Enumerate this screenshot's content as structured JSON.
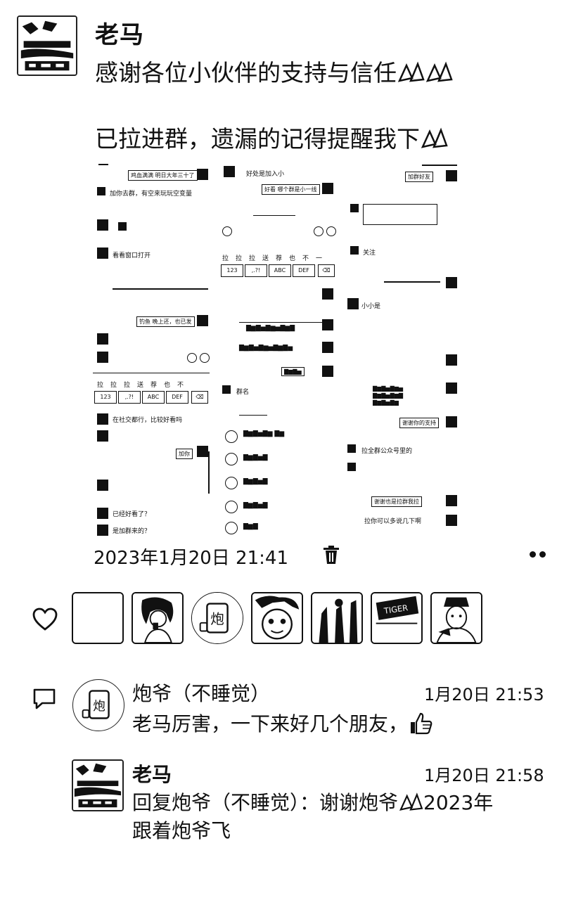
{
  "post": {
    "author": "老马",
    "line1": "感谢各位小伙伴的支持与信任",
    "line2": "已拉进群，遗漏的记得提醒我下",
    "timestamp": "2023年1月20日 21:41"
  },
  "screenshots": {
    "col1": {
      "b1": "鸡血满满 明日大年三十了",
      "m1": "加你去群，有空来玩玩空变量",
      "m2": "看看窗口打开",
      "b2": "钓鱼 晚上还，也已发",
      "m3": "在社交都行，比较好看吗",
      "m4": "已经好看了？",
      "m5": "是加群来的？",
      "keys_top": [
        "拉",
        "拉",
        "拉",
        "送",
        "荐",
        "也",
        "不"
      ],
      "keys_bottom": [
        "123",
        ",.?!",
        "ABC",
        "DEF"
      ]
    },
    "col2": {
      "m1": "好处是加入小",
      "b1": "好看 哪个群是小一线",
      "keys_top": [
        "拉",
        "拉",
        "拉",
        "送",
        "荐",
        "也",
        "不",
        "一"
      ],
      "keys_bottom": [
        "123",
        ",.?!",
        "ABC",
        "DEF"
      ],
      "m2": "群名",
      "item_label": "小米"
    },
    "col3": {
      "b1": "加群好友",
      "m1": "关注",
      "m2": "小小是",
      "b2": "谢谢你的支持",
      "m3": "拉全群公众号里的",
      "b3": "谢谢也是拉群我拉",
      "m4": "拉你可以多说几下啊"
    }
  },
  "likes": {
    "count_avatars": 7
  },
  "comments": [
    {
      "author": "炮爷（不睡觉）",
      "time": "1月20日 21:53",
      "text": "老马厉害，一下来好几个朋友，"
    },
    {
      "author": "老马",
      "time": "1月20日 21:58",
      "text_line1": "回复炮爷（不睡觉）：谢谢炮爷",
      "text_line1_tail": "2023年",
      "text_line2": "跟着炮爷飞"
    }
  ]
}
